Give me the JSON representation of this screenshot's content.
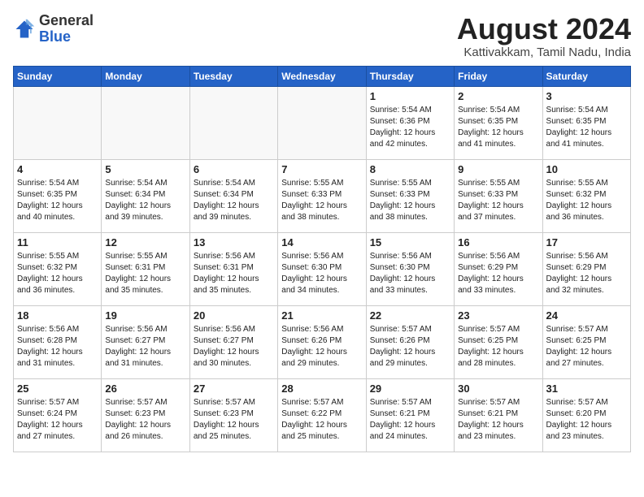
{
  "header": {
    "logo_general": "General",
    "logo_blue": "Blue",
    "month_year": "August 2024",
    "location": "Kattivakkam, Tamil Nadu, India"
  },
  "weekdays": [
    "Sunday",
    "Monday",
    "Tuesday",
    "Wednesday",
    "Thursday",
    "Friday",
    "Saturday"
  ],
  "weeks": [
    [
      {
        "day": "",
        "info": ""
      },
      {
        "day": "",
        "info": ""
      },
      {
        "day": "",
        "info": ""
      },
      {
        "day": "",
        "info": ""
      },
      {
        "day": "1",
        "info": "Sunrise: 5:54 AM\nSunset: 6:36 PM\nDaylight: 12 hours\nand 42 minutes."
      },
      {
        "day": "2",
        "info": "Sunrise: 5:54 AM\nSunset: 6:35 PM\nDaylight: 12 hours\nand 41 minutes."
      },
      {
        "day": "3",
        "info": "Sunrise: 5:54 AM\nSunset: 6:35 PM\nDaylight: 12 hours\nand 41 minutes."
      }
    ],
    [
      {
        "day": "4",
        "info": "Sunrise: 5:54 AM\nSunset: 6:35 PM\nDaylight: 12 hours\nand 40 minutes."
      },
      {
        "day": "5",
        "info": "Sunrise: 5:54 AM\nSunset: 6:34 PM\nDaylight: 12 hours\nand 39 minutes."
      },
      {
        "day": "6",
        "info": "Sunrise: 5:54 AM\nSunset: 6:34 PM\nDaylight: 12 hours\nand 39 minutes."
      },
      {
        "day": "7",
        "info": "Sunrise: 5:55 AM\nSunset: 6:33 PM\nDaylight: 12 hours\nand 38 minutes."
      },
      {
        "day": "8",
        "info": "Sunrise: 5:55 AM\nSunset: 6:33 PM\nDaylight: 12 hours\nand 38 minutes."
      },
      {
        "day": "9",
        "info": "Sunrise: 5:55 AM\nSunset: 6:33 PM\nDaylight: 12 hours\nand 37 minutes."
      },
      {
        "day": "10",
        "info": "Sunrise: 5:55 AM\nSunset: 6:32 PM\nDaylight: 12 hours\nand 36 minutes."
      }
    ],
    [
      {
        "day": "11",
        "info": "Sunrise: 5:55 AM\nSunset: 6:32 PM\nDaylight: 12 hours\nand 36 minutes."
      },
      {
        "day": "12",
        "info": "Sunrise: 5:55 AM\nSunset: 6:31 PM\nDaylight: 12 hours\nand 35 minutes."
      },
      {
        "day": "13",
        "info": "Sunrise: 5:56 AM\nSunset: 6:31 PM\nDaylight: 12 hours\nand 35 minutes."
      },
      {
        "day": "14",
        "info": "Sunrise: 5:56 AM\nSunset: 6:30 PM\nDaylight: 12 hours\nand 34 minutes."
      },
      {
        "day": "15",
        "info": "Sunrise: 5:56 AM\nSunset: 6:30 PM\nDaylight: 12 hours\nand 33 minutes."
      },
      {
        "day": "16",
        "info": "Sunrise: 5:56 AM\nSunset: 6:29 PM\nDaylight: 12 hours\nand 33 minutes."
      },
      {
        "day": "17",
        "info": "Sunrise: 5:56 AM\nSunset: 6:29 PM\nDaylight: 12 hours\nand 32 minutes."
      }
    ],
    [
      {
        "day": "18",
        "info": "Sunrise: 5:56 AM\nSunset: 6:28 PM\nDaylight: 12 hours\nand 31 minutes."
      },
      {
        "day": "19",
        "info": "Sunrise: 5:56 AM\nSunset: 6:27 PM\nDaylight: 12 hours\nand 31 minutes."
      },
      {
        "day": "20",
        "info": "Sunrise: 5:56 AM\nSunset: 6:27 PM\nDaylight: 12 hours\nand 30 minutes."
      },
      {
        "day": "21",
        "info": "Sunrise: 5:56 AM\nSunset: 6:26 PM\nDaylight: 12 hours\nand 29 minutes."
      },
      {
        "day": "22",
        "info": "Sunrise: 5:57 AM\nSunset: 6:26 PM\nDaylight: 12 hours\nand 29 minutes."
      },
      {
        "day": "23",
        "info": "Sunrise: 5:57 AM\nSunset: 6:25 PM\nDaylight: 12 hours\nand 28 minutes."
      },
      {
        "day": "24",
        "info": "Sunrise: 5:57 AM\nSunset: 6:25 PM\nDaylight: 12 hours\nand 27 minutes."
      }
    ],
    [
      {
        "day": "25",
        "info": "Sunrise: 5:57 AM\nSunset: 6:24 PM\nDaylight: 12 hours\nand 27 minutes."
      },
      {
        "day": "26",
        "info": "Sunrise: 5:57 AM\nSunset: 6:23 PM\nDaylight: 12 hours\nand 26 minutes."
      },
      {
        "day": "27",
        "info": "Sunrise: 5:57 AM\nSunset: 6:23 PM\nDaylight: 12 hours\nand 25 minutes."
      },
      {
        "day": "28",
        "info": "Sunrise: 5:57 AM\nSunset: 6:22 PM\nDaylight: 12 hours\nand 25 minutes."
      },
      {
        "day": "29",
        "info": "Sunrise: 5:57 AM\nSunset: 6:21 PM\nDaylight: 12 hours\nand 24 minutes."
      },
      {
        "day": "30",
        "info": "Sunrise: 5:57 AM\nSunset: 6:21 PM\nDaylight: 12 hours\nand 23 minutes."
      },
      {
        "day": "31",
        "info": "Sunrise: 5:57 AM\nSunset: 6:20 PM\nDaylight: 12 hours\nand 23 minutes."
      }
    ]
  ]
}
